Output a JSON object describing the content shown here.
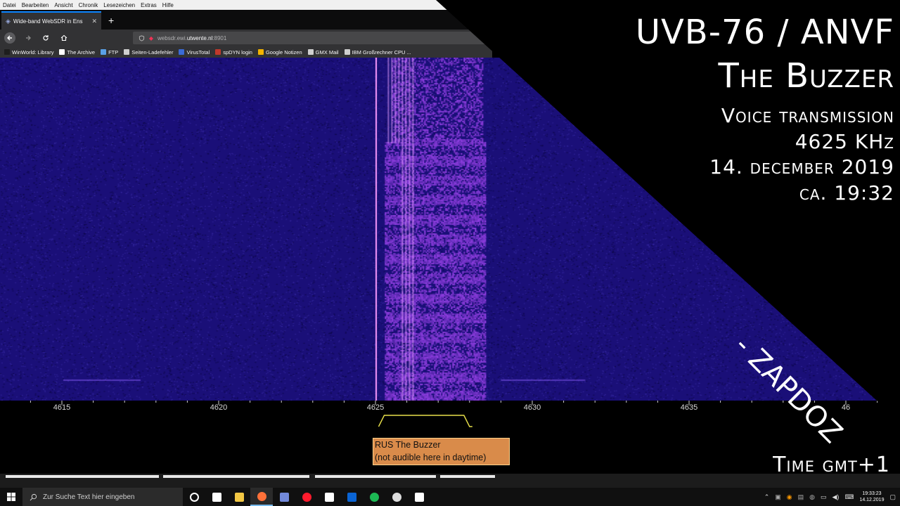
{
  "browser": {
    "menu": [
      "Datei",
      "Bearbeiten",
      "Ansicht",
      "Chronik",
      "Lesezeichen",
      "Extras",
      "Hilfe"
    ],
    "tab_title": "Wide-band WebSDR in Ens",
    "tab_close": "✕",
    "new_tab": "+",
    "url_prefix": "websdr.ewi.",
    "url_domain": "utwente.nl",
    "url_suffix": ":8901",
    "bookmarks": [
      {
        "label": "WinWorld: Library",
        "color": "#1e1e1e"
      },
      {
        "label": "The Archive",
        "color": "#ffffff"
      },
      {
        "label": "FTP",
        "color": "#5aa0e6"
      },
      {
        "label": "Seiten-Ladefehler",
        "color": "#cfcfcf"
      },
      {
        "label": "VirusTotal",
        "color": "#3b6bd6"
      },
      {
        "label": "spDYN login",
        "color": "#c0392b"
      },
      {
        "label": "Google Notizen",
        "color": "#f4b400"
      },
      {
        "label": "GMX Mail",
        "color": "#cfcfcf"
      },
      {
        "label": "IBM Großrechner CPU ...",
        "color": "#cfcfcf"
      }
    ]
  },
  "spectrum": {
    "freq_unit": "kHz",
    "ticks": [
      {
        "label": "4615",
        "khz": 4615
      },
      {
        "label": "4620",
        "khz": 4620
      },
      {
        "label": "4625",
        "khz": 4625
      },
      {
        "label": "4630",
        "khz": 4630
      },
      {
        "label": "4635",
        "khz": 4635
      },
      {
        "label": "46",
        "khz": 4640
      }
    ],
    "range_khz": [
      4613,
      4641.6
    ],
    "signal_carrier_khz": 4625,
    "signal_band_khz": [
      4625.3,
      4628.5
    ],
    "passband_khz": [
      4625.1,
      4628.0
    ],
    "station_label_line1": "RUS The Buzzer",
    "station_label_line2": "(not audible here in daytime)",
    "colors": {
      "background": "#1a0f78",
      "signal": "#b24cff",
      "carrier": "#ff9cff",
      "passband": "#e8e04a"
    }
  },
  "overlay": {
    "title": "UVB-76 / ANVF",
    "subtitle": "The Buzzer",
    "voice": "Voice transmission",
    "freq": "4625 KHz",
    "date": "14. december 2019",
    "time": "ca. 19:32",
    "signature": "- ZAPDOZ",
    "timezone": "Time gmt+1"
  },
  "taskbar": {
    "search_placeholder": "Zur Suche Text hier eingeben",
    "apps": [
      {
        "name": "cortana-icon",
        "color": "#ffffff"
      },
      {
        "name": "task-view-icon",
        "color": "#ffffff"
      },
      {
        "name": "explorer-icon",
        "color": "#f2c744"
      },
      {
        "name": "firefox-icon",
        "color": "#ff7139"
      },
      {
        "name": "discord-icon",
        "color": "#7289da"
      },
      {
        "name": "opera-icon",
        "color": "#ff1b2d"
      },
      {
        "name": "store-icon",
        "color": "#ffffff"
      },
      {
        "name": "outlook-icon",
        "color": "#0a64d4"
      },
      {
        "name": "spotify-icon",
        "color": "#1db954"
      },
      {
        "name": "obs-icon",
        "color": "#dddddd"
      },
      {
        "name": "settings-icon",
        "color": "#ffffff"
      }
    ],
    "clock_time": "19:33:23",
    "clock_date": "14.12.2019"
  }
}
